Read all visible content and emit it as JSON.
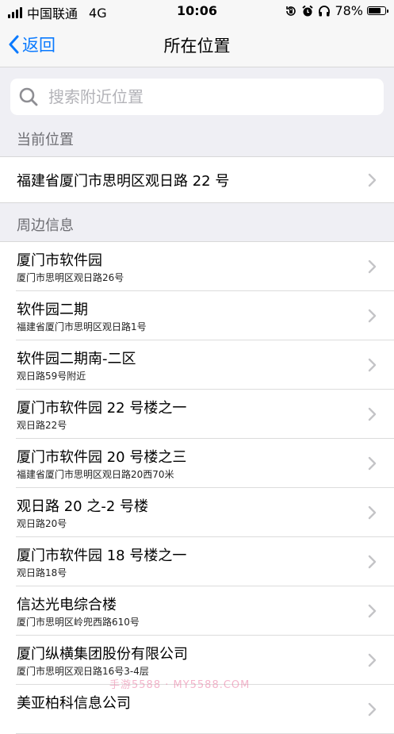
{
  "status": {
    "carrier": "中国联通",
    "network": "4G",
    "time": "10:06",
    "battery": "78%",
    "battery_level": 0.78,
    "icons": [
      "signal-icon",
      "rotation-lock-icon",
      "alarm-icon",
      "headphones-icon",
      "battery-icon"
    ]
  },
  "nav": {
    "back_label": "返回",
    "title": "所在位置"
  },
  "search": {
    "placeholder": "搜索附近位置"
  },
  "current": {
    "header": "当前位置",
    "address": "福建省厦门市思明区观日路 22 号"
  },
  "nearby": {
    "header": "周边信息",
    "items": [
      {
        "name": "厦门市软件园",
        "address": "厦门市思明区观日路26号"
      },
      {
        "name": "软件园二期",
        "address": "福建省厦门市思明区观日路1号"
      },
      {
        "name": "软件园二期南-二区",
        "address": "观日路59号附近"
      },
      {
        "name": "厦门市软件园 22 号楼之一",
        "address": "观日路22号"
      },
      {
        "name": "厦门市软件园 20 号楼之三",
        "address": "福建省厦门市思明区观日路20西70米"
      },
      {
        "name": "观日路 20 之-2 号楼",
        "address": "观日路20号"
      },
      {
        "name": "厦门市软件园 18 号楼之一",
        "address": "观日路18号"
      },
      {
        "name": "信达光电综合楼",
        "address": "厦门市思明区岭兜西路610号"
      },
      {
        "name": "厦门纵横集团股份有限公司",
        "address": "厦门市思明区观日路16号3-4层"
      },
      {
        "name": "美亚柏科信息公司",
        "address": ""
      }
    ]
  },
  "watermark": "手游5588 · MY5588.COM",
  "colors": {
    "accent": "#0a7aff",
    "background": "#efeff4",
    "chevron": "#c4c4c7"
  }
}
